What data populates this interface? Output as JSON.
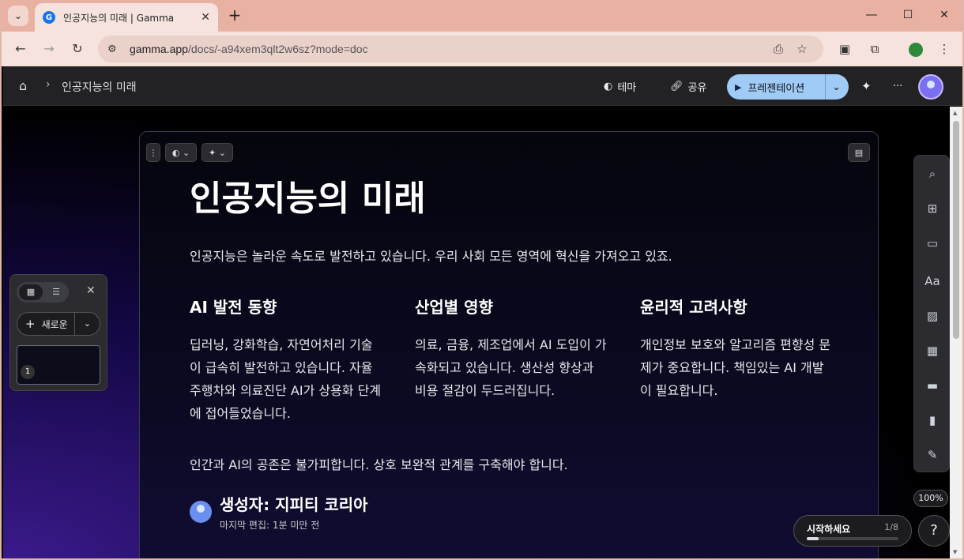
{
  "browser": {
    "tab_title": "인공지능의 미래 | Gamma",
    "tab_favicon": "G",
    "url_host": "gamma.app",
    "url_path": "/docs/-a94xem3qlt2w6sz?mode=doc"
  },
  "app_header": {
    "breadcrumb": "인공지능의 미래",
    "theme_label": "테마",
    "share_label": "공유",
    "present_label": "프레젠테이션"
  },
  "doc": {
    "title": "인공지능의 미래",
    "intro": "인공지능은 놀라운 속도로 발전하고 있습니다. 우리 사회 모든 영역에 혁신을 가져오고 있죠.",
    "columns": [
      {
        "heading": "AI 발전 동향",
        "body": "딥러닝, 강화학습, 자연어처리 기술이 급속히 발전하고 있습니다. 자율주행차와 의료진단 AI가 상용화 단계에 접어들었습니다."
      },
      {
        "heading": "산업별 영향",
        "body": "의료, 금융, 제조업에서 AI 도입이 가속화되고 있습니다. 생산성 향상과 비용 절감이 두드러집니다."
      },
      {
        "heading": "윤리적 고려사항",
        "body": "개인정보 보호와 알고리즘 편향성 문제가 중요합니다. 책임있는 AI 개발이 필요합니다."
      }
    ],
    "closing": "인간과 AI의 공존은 불가피합니다. 상호 보완적 관계를 구축해야 합니다.",
    "author": "생성자: 지피티 코리아",
    "last_edit": "마지막 편집: 1분 미만 전"
  },
  "left_panel": {
    "new_label": "새로운",
    "thumbnail_number": "1"
  },
  "zoom_level": "100%",
  "onboarding": {
    "label": "시작하세요",
    "progress_text": "1/8",
    "progress_fraction": 0.125
  },
  "help_label": "?",
  "colors": {
    "tab_strip": "#e8b1a2",
    "present_button": "#9fcbf6",
    "header_bg": "#222225"
  }
}
